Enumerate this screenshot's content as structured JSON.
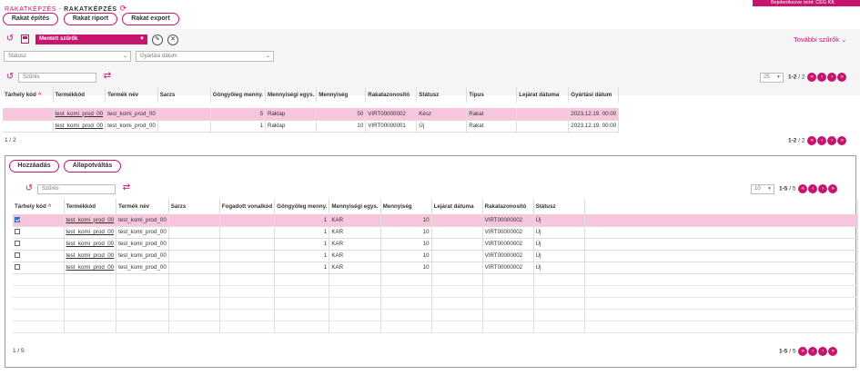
{
  "header": {
    "breadcrumb_parent": "RAKATKÉPZÉS",
    "breadcrumb_sep": " - ",
    "breadcrumb_current": "RAKATKÉPZÉS",
    "login_text": "Bejelentkezve mint: CÉG Kft.",
    "accent_color": "#c8146e"
  },
  "toolbar": {
    "build_label": "Rakat építés",
    "report_label": "Rakat riport",
    "export_label": "Rakat export"
  },
  "filters": {
    "saved_filters_label": "Mentett szűrők",
    "more_filters_label": "További szűrők",
    "status_placeholder": "Státusz",
    "production_date_placeholder": "Gyártási dátum"
  },
  "top_grid": {
    "search_placeholder": "Szűrés",
    "page_size": "25",
    "range": "1-2",
    "total": "2",
    "page_current": "1",
    "page_total": "2",
    "columns": [
      "Tárhely kód",
      "Termékkód",
      "Termék név",
      "Sarzs",
      "Göngyöleg menny.",
      "Mennyiségi egys.",
      "Mennyiség",
      "Rakatazonosító",
      "Státusz",
      "Típus",
      "Lejárat dátuma",
      "Gyártási dátum"
    ],
    "rows": [
      [
        "",
        "test_komi_prod_00",
        "test_komi_prod_00",
        "",
        "5",
        "Raklap",
        "50",
        "VIRT00000002",
        "Kész",
        "Rakat",
        "",
        "2023.12.19. 00:00"
      ],
      [
        "",
        "test_komi_prod_00",
        "test_komi_prod_00",
        "",
        "1",
        "Raklap",
        "10",
        "VIRT00000001",
        "Új",
        "Rakat",
        "",
        "2023.12.19. 00:00"
      ]
    ]
  },
  "bottom_panel": {
    "add_label": "Hozzáadás",
    "status_change_label": "Állapotváltás",
    "search_placeholder": "Szűrés",
    "page_size": "10",
    "range": "1-5",
    "total": "5",
    "page_current": "1",
    "page_total": "5",
    "columns": [
      "Tárhely kód",
      "Termékkód",
      "Termék név",
      "Sarzs",
      "Fogadott vonalkód",
      "Göngyöleg menny.",
      "Mennyiségi egys.",
      "Mennyiség",
      "Lejárat dátuma",
      "Rakatazonosító",
      "Státusz"
    ],
    "rows": [
      {
        "checked": true,
        "cells": [
          "",
          "test_komi_prod_00",
          "test_komi_prod_00",
          "",
          "",
          "1",
          "KAR",
          "10",
          "",
          "VIRT00000002",
          "Új"
        ]
      },
      {
        "checked": false,
        "cells": [
          "",
          "test_komi_prod_00",
          "test_komi_prod_00",
          "",
          "",
          "1",
          "KAR",
          "10",
          "",
          "VIRT00000002",
          "Új"
        ]
      },
      {
        "checked": false,
        "cells": [
          "",
          "test_komi_prod_00",
          "test_komi_prod_00",
          "",
          "",
          "1",
          "KAR",
          "10",
          "",
          "VIRT00000002",
          "Új"
        ]
      },
      {
        "checked": false,
        "cells": [
          "",
          "test_komi_prod_00",
          "test_komi_prod_00",
          "",
          "",
          "1",
          "KAR",
          "10",
          "",
          "VIRT00000002",
          "Új"
        ]
      },
      {
        "checked": false,
        "cells": [
          "",
          "test_komi_prod_00",
          "test_komi_prod_00",
          "",
          "",
          "1",
          "KAR",
          "10",
          "",
          "VIRT00000002",
          "Új"
        ]
      }
    ]
  },
  "icons": {
    "refresh": "refresh-icon",
    "save": "save-icon",
    "edit": "pencil-icon",
    "clear": "close-icon",
    "swap": "swap-icon",
    "first": "first-page-icon",
    "prev": "prev-page-icon",
    "next": "next-page-icon",
    "last": "last-page-icon"
  }
}
